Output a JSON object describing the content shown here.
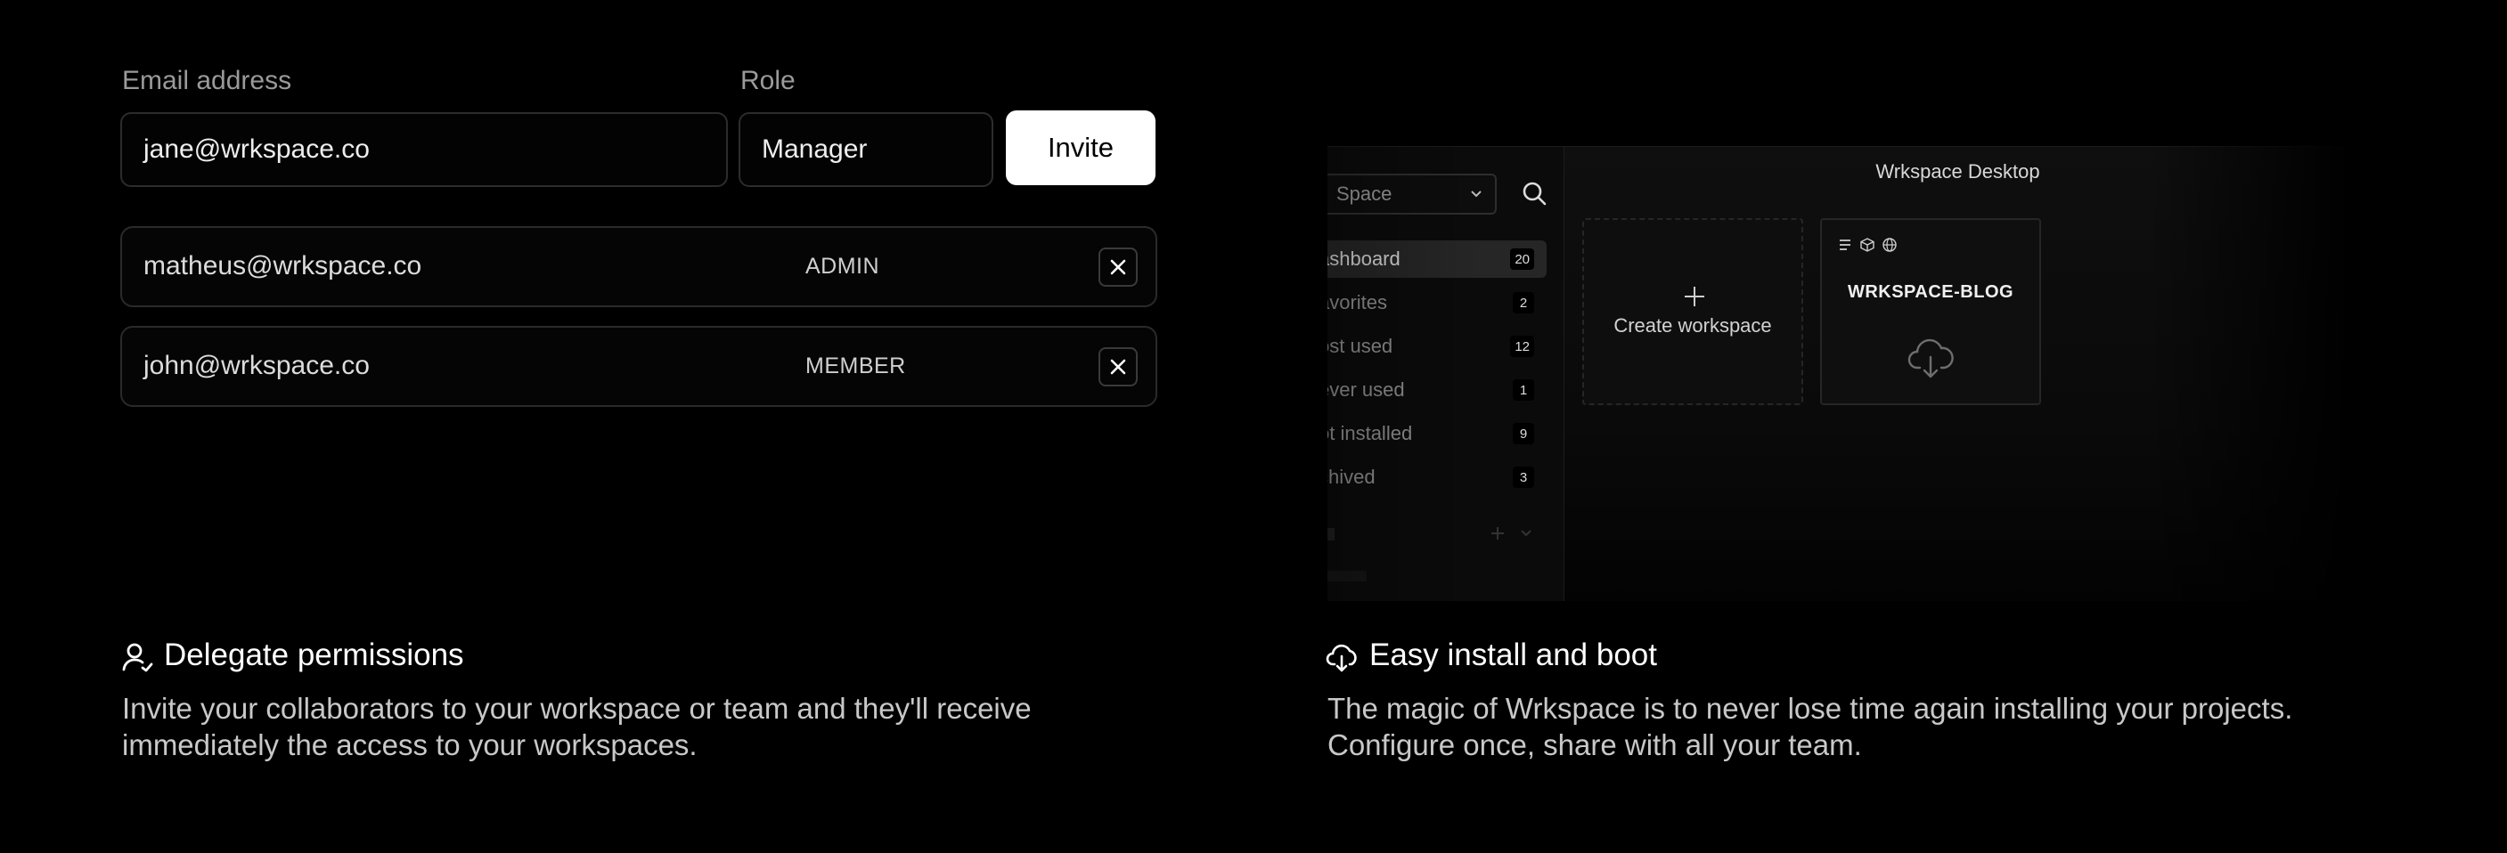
{
  "invite_form": {
    "email_label": "Email address",
    "role_label": "Role",
    "email_value": "jane@wrkspace.co",
    "role_value": "Manager",
    "invite_button": "Invite"
  },
  "members": [
    {
      "email": "matheus@wrkspace.co",
      "role": "ADMIN"
    },
    {
      "email": "john@wrkspace.co",
      "role": "MEMBER"
    }
  ],
  "preview": {
    "window_title": "Wrkspace Desktop",
    "workspace_select": "Space",
    "nav": [
      {
        "label": "ashboard",
        "count": "20"
      },
      {
        "label": "avorites",
        "count": "2"
      },
      {
        "label": "ost used",
        "count": "12"
      },
      {
        "label": "ever used",
        "count": "1"
      },
      {
        "label": "ot installed",
        "count": "9"
      },
      {
        "label": "chived",
        "count": "3"
      }
    ],
    "create_card_label": "Create workspace",
    "workspace_card_title": "WRKSPACE-BLOG"
  },
  "features": [
    {
      "icon": "user-icon",
      "title": "Delegate permissions",
      "description": "Invite your collaborators to your workspace or team and they'll receive immediately the access to your workspaces."
    },
    {
      "icon": "cloud-download-icon",
      "title": "Easy install and boot",
      "description": "The magic of Wrkspace is to never lose time again installing your projects. Configure once, share with all your team."
    }
  ]
}
